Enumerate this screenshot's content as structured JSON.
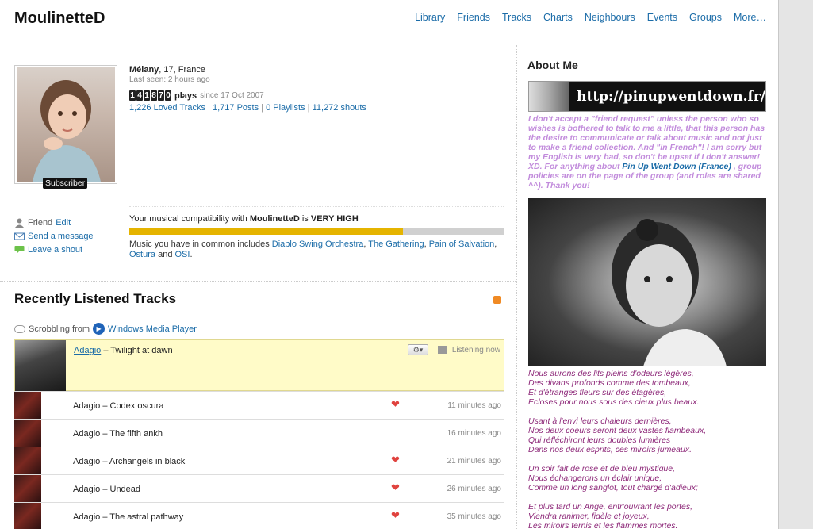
{
  "header": {
    "username": "MoulinetteD",
    "nav": [
      "Library",
      "Friends",
      "Tracks",
      "Charts",
      "Neighbours",
      "Events",
      "Groups",
      "More…"
    ]
  },
  "profile": {
    "name": "Mélany",
    "details": ", 17, France",
    "last_seen": "Last seen: 2 hours ago",
    "play_digits": [
      "1",
      "4",
      "1",
      "8",
      "7",
      "0"
    ],
    "plays_label": "plays",
    "since": "since 17 Oct 2007",
    "loved": "1,226 Loved Tracks",
    "posts": "1,717 Posts",
    "playlists": "0 Playlists",
    "shouts": "11,272 shouts",
    "badge": "Subscriber"
  },
  "actions": {
    "friend_label": "Friend",
    "edit_label": "Edit",
    "message_label": "Send a message",
    "shout_label": "Leave a shout"
  },
  "compat": {
    "prefix": "Your musical compatibility with",
    "user": "MoulinetteD",
    "is": "is",
    "level": "VERY HIGH",
    "fill_fraction": 0.73,
    "common_prefix": "Music you have in common includes",
    "artists": [
      "Diablo Swing Orchestra",
      "The Gathering",
      "Pain of Salvation",
      "Ostura",
      "OSI"
    ],
    "and": "and"
  },
  "recent": {
    "title": "Recently Listened Tracks",
    "scrobbling_label": "Scrobbling from",
    "player": "Windows Media Player",
    "tracks": [
      {
        "artist": "Adagio",
        "title": "Twilight at dawn",
        "time": "Listening now",
        "loved": false,
        "now": true
      },
      {
        "artist": "Adagio",
        "title": "Codex oscura",
        "time": "11 minutes ago",
        "loved": true,
        "now": false
      },
      {
        "artist": "Adagio",
        "title": "The fifth ankh",
        "time": "16 minutes ago",
        "loved": false,
        "now": false
      },
      {
        "artist": "Adagio",
        "title": "Archangels in black",
        "time": "21 minutes ago",
        "loved": true,
        "now": false
      },
      {
        "artist": "Adagio",
        "title": "Undead",
        "time": "26 minutes ago",
        "loved": true,
        "now": false
      },
      {
        "artist": "Adagio",
        "title": "The astral pathway",
        "time": "35 minutes ago",
        "loved": true,
        "now": false
      }
    ]
  },
  "about": {
    "title": "About Me",
    "banner_url": "http://pinupwentdown.fr/",
    "text_before": "I don't accept a \"friend request\" unless the person who so wishes is bothered to talk to me a little, that this person has the desire to communicate or talk about music and not just to make a friend collection. And \"in French\"! I am sorry but my English is very bad, so don't be upset if I don't answer! XD. For anything about",
    "text_link": "Pin Up Went Down (France)",
    "text_after": ", group policies are on the page of the group (and roles are shared ^^). Thank you!",
    "poem": [
      [
        "Nous aurons des lits pleins d'odeurs légères,",
        "Des divans profonds comme des tombeaux,",
        "Et d'étranges fleurs sur des étagères,",
        "Ecloses pour nous sous des cieux plus beaux."
      ],
      [
        "Usant à l'envi leurs chaleurs dernières,",
        "Nos deux coeurs seront deux vastes flambeaux,",
        "Qui réfléchiront leurs doubles lumières",
        "Dans nos deux esprits, ces miroirs jumeaux."
      ],
      [
        "Un soir fait de rose et de bleu mystique,",
        "Nous échangerons un éclair unique,",
        "Comme un long sanglot, tout chargé d'adieux;"
      ],
      [
        "Et plus tard un Ange, entr'ouvrant les portes,",
        "Viendra ranimer, fidèle et joyeux,",
        "Les miroirs ternis et les flammes mortes."
      ]
    ]
  },
  "colors": {
    "accent": "#1b6ca8",
    "bar_fill": "#e5b400",
    "now_playing_bg": "#fffbc8",
    "about_text": "#c28cdc",
    "poem_text": "#8e2a7a"
  }
}
